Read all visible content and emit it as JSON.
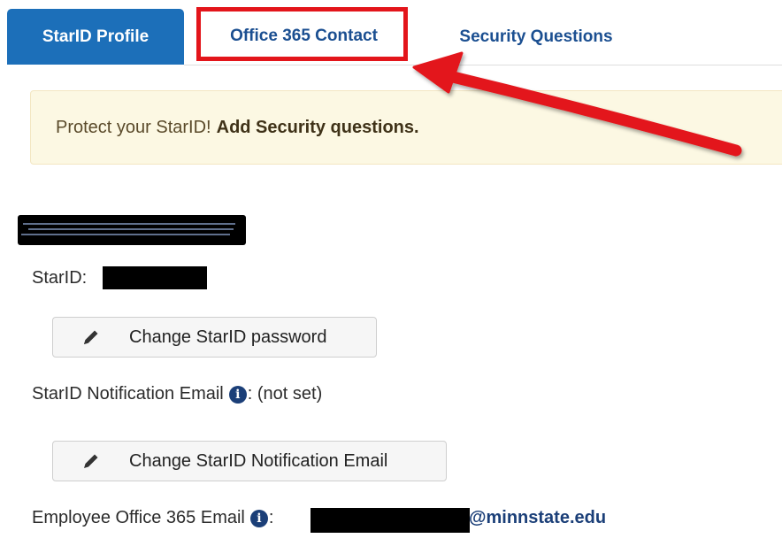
{
  "tabs": {
    "profile_label": "StarID Profile",
    "office_label": "Office 365 Contact",
    "security_label": "Security Questions"
  },
  "alert": {
    "text": "Protect your StarID!",
    "strong": "Add Security questions."
  },
  "profile": {
    "starid_label": "StarID:",
    "change_password_label": "Change StarID password",
    "notification_label": "StarID Notification Email",
    "notification_value": ": (not set)",
    "change_email_label": "Change StarID Notification Email",
    "employee_email_label": "Employee Office 365 Email",
    "employee_email_sep": ":",
    "employee_email_domain": "@minnstate.edu"
  },
  "colors": {
    "active_tab": "#1c6fb9",
    "tab_text": "#1b4f91",
    "highlight": "#e3151b",
    "alert_bg": "#fcf8e3"
  },
  "icons": [
    "pencil-icon",
    "info-icon",
    "arrow-annotation"
  ]
}
